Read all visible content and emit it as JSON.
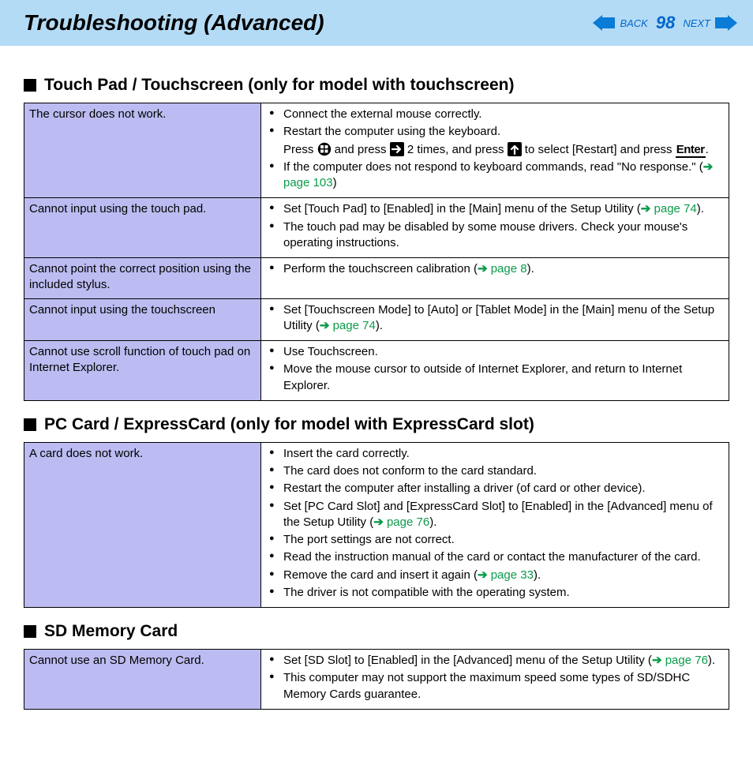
{
  "header": {
    "title": "Troubleshooting (Advanced)",
    "back_label": "BACK",
    "next_label": "NEXT",
    "page_number": "98"
  },
  "sections": [
    {
      "heading": "Touch Pad / Touchscreen (only for model with touchscreen)",
      "rows": [
        {
          "symptom": "The cursor does not work.",
          "solutions": [
            {
              "type": "li",
              "text": "Connect the external mouse correctly."
            },
            {
              "type": "li",
              "text": "Restart the computer using the keyboard."
            },
            {
              "type": "sub",
              "html": "Press {WIN} and press {RIGHT} 2 times, and press {UP} to select [Restart] and press {KEY:Enter}."
            },
            {
              "type": "li",
              "html": "If the computer does not respond to keyboard commands, read \"No response.\" ({LINK:page 103})"
            }
          ]
        },
        {
          "symptom": "Cannot input using the touch pad.",
          "solutions": [
            {
              "type": "li",
              "html": "Set [Touch Pad] to [Enabled] in the [Main] menu of the Setup Utility ({LINK:page 74})."
            },
            {
              "type": "li",
              "text": "The touch pad may be disabled by some mouse drivers. Check your mouse's operating instructions."
            }
          ]
        },
        {
          "symptom": "Cannot point the correct position using the included stylus.",
          "solutions": [
            {
              "type": "li",
              "html": "Perform the touchscreen calibration ({LINK:page 8})."
            }
          ]
        },
        {
          "symptom": "Cannot input using the touchscreen",
          "solutions": [
            {
              "type": "li",
              "html": "Set [Touchscreen Mode] to [Auto] or [Tablet Mode] in the [Main] menu of the Setup Utility ({LINK:page 74})."
            }
          ]
        },
        {
          "symptom": "Cannot use scroll function of touch pad on Internet Explorer.",
          "solutions": [
            {
              "type": "li",
              "text": "Use Touchscreen."
            },
            {
              "type": "li",
              "text": "Move the mouse cursor to outside of Internet Explorer, and return to Internet Explorer."
            }
          ]
        }
      ]
    },
    {
      "heading": "PC Card / ExpressCard (only for model with ExpressCard slot)",
      "rows": [
        {
          "symptom": "A card does not work.",
          "solutions": [
            {
              "type": "li",
              "text": "Insert the card correctly."
            },
            {
              "type": "li",
              "text": "The card does not conform to the card standard."
            },
            {
              "type": "li",
              "text": "Restart the computer after installing a driver (of card or other device)."
            },
            {
              "type": "li",
              "html": "Set [PC Card Slot] and [ExpressCard Slot] to [Enabled] in the [Advanced] menu of the Setup Utility ({LINK:page 76})."
            },
            {
              "type": "li",
              "text": "The port settings are not correct."
            },
            {
              "type": "li",
              "text": "Read the instruction manual of the card or contact the manufacturer of the card."
            },
            {
              "type": "li",
              "html": "Remove the card and insert it again ({LINK:page 33})."
            },
            {
              "type": "li",
              "text": "The driver is not compatible with the operating system."
            }
          ]
        }
      ]
    },
    {
      "heading": "SD Memory Card",
      "rows": [
        {
          "symptom": "Cannot use an SD Memory Card.",
          "solutions": [
            {
              "type": "li",
              "html": "Set [SD Slot] to [Enabled] in the [Advanced] menu of the Setup Utility ({LINK:page 76})."
            },
            {
              "type": "li",
              "text": "This computer may not support the maximum speed some types of SD/SDHC Memory Cards guarantee."
            }
          ]
        }
      ]
    }
  ]
}
